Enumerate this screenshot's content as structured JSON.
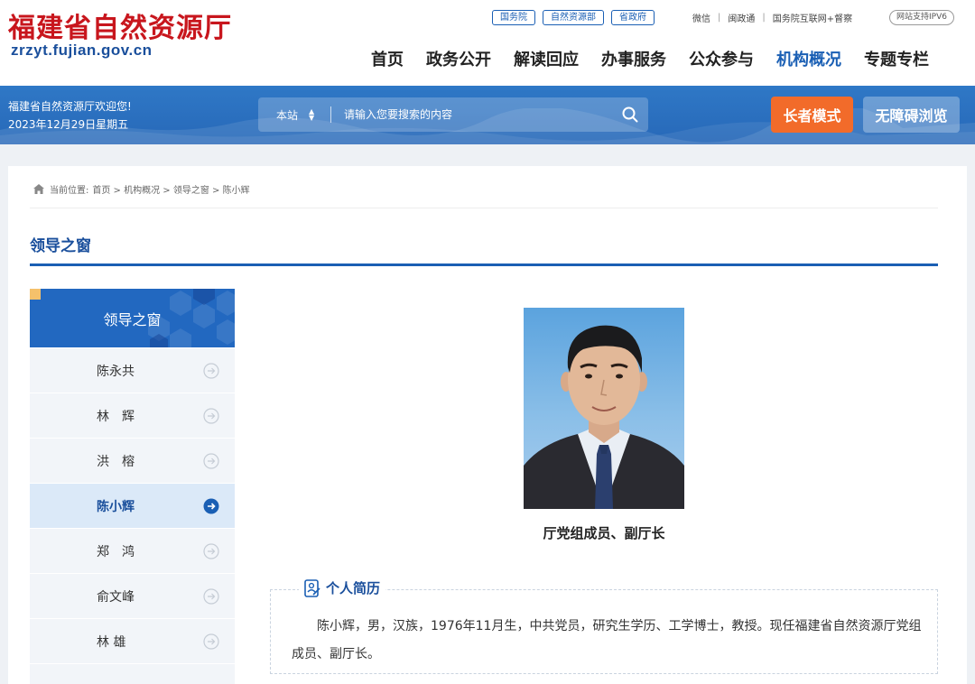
{
  "header": {
    "logo_cn": "福建省自然资源厅",
    "logo_url": "zrzyt.fujian.gov.cn",
    "top_tags": [
      "国务院",
      "自然资源部",
      "省政府"
    ],
    "top_links": [
      "微信",
      "闽政通",
      "国务院互联网+督察"
    ],
    "ipv6": "网站支持IPV6",
    "nav": [
      "首页",
      "政务公开",
      "解读回应",
      "办事服务",
      "公众参与",
      "机构概况",
      "专题专栏"
    ],
    "nav_active": "机构概况"
  },
  "banner": {
    "welcome": "福建省自然资源厅欢迎您!",
    "date": "2023年12月29日星期五",
    "search_scope": "本站",
    "search_placeholder": "请输入您要搜索的内容",
    "elder_mode": "长者模式",
    "accessible": "无障碍浏览"
  },
  "breadcrumb": {
    "label": "当前位置:",
    "path": "首页 > 机构概况 > 领导之窗 > 陈小辉"
  },
  "section_title": "领导之窗",
  "sidebar": {
    "title": "领导之窗",
    "items": [
      {
        "label": "陈永共",
        "active": false
      },
      {
        "label": "林　辉",
        "active": false
      },
      {
        "label": "洪　榕",
        "active": false
      },
      {
        "label": "陈小辉",
        "active": true
      },
      {
        "label": "郑　鸿",
        "active": false
      },
      {
        "label": "俞文峰",
        "active": false
      },
      {
        "label": "林 雄",
        "active": false
      },
      {
        "label": "",
        "active": false
      }
    ]
  },
  "profile": {
    "job_title": "厅党组成员、副厅长",
    "resume_heading": "个人简历",
    "resume_text": "陈小辉，男，汉族，1976年11月生，中共党员，研究生学历、工学博士，教授。现任福建省自然资源厅党组成员、副厅长。"
  },
  "colors": {
    "logo_red": "#c8161d",
    "brand_blue": "#1a5fb4",
    "banner_blue": "#2f78c6",
    "elder_orange": "#f26b2a"
  }
}
